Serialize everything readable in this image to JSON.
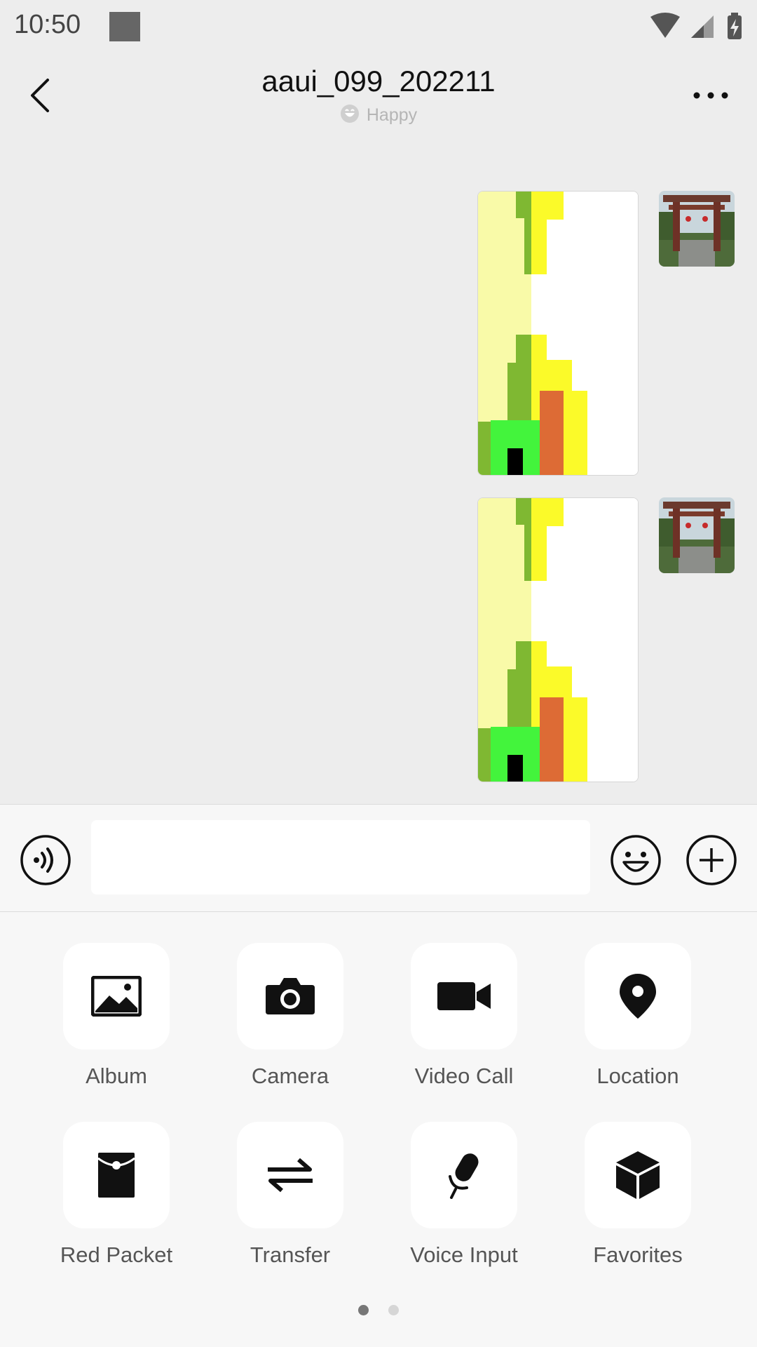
{
  "status_bar": {
    "time": "10:50"
  },
  "header": {
    "title": "aaui_099_202211",
    "status": "Happy"
  },
  "input": {
    "value": "",
    "placeholder": ""
  },
  "panel": {
    "tools": [
      {
        "label": "Album",
        "icon": "image-icon"
      },
      {
        "label": "Camera",
        "icon": "camera-icon"
      },
      {
        "label": "Video Call",
        "icon": "video-camera-icon"
      },
      {
        "label": "Location",
        "icon": "location-pin-icon"
      },
      {
        "label": "Red Packet",
        "icon": "red-packet-icon"
      },
      {
        "label": "Transfer",
        "icon": "transfer-arrows-icon"
      },
      {
        "label": "Voice Input",
        "icon": "microphone-icon"
      },
      {
        "label": "Favorites",
        "icon": "cube-icon"
      }
    ],
    "page_count": 2,
    "active_page": 1
  }
}
